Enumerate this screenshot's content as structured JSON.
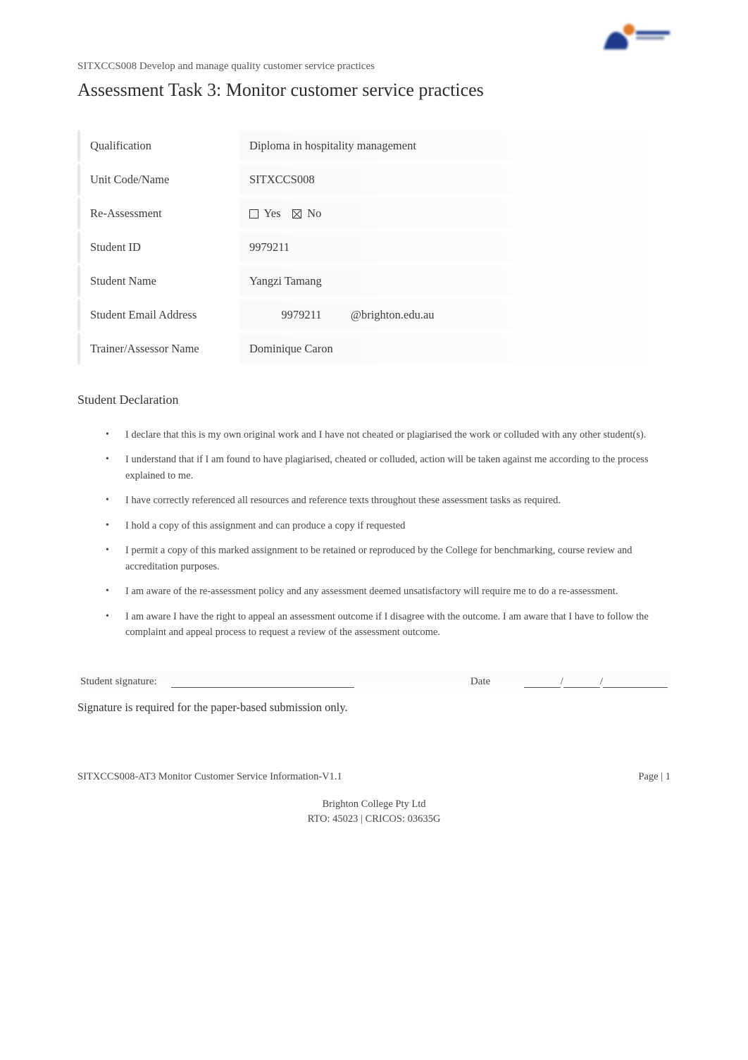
{
  "header": {
    "course_code_line": "SITXCCS008 Develop and manage quality customer service practices",
    "title": "Assessment Task 3: Monitor customer service practices"
  },
  "info_rows": {
    "qualification_label": "Qualification",
    "qualification_value": "Diploma in hospitality management",
    "unitcodename_label": "Unit Code/Name",
    "unitcodename_value": "SITXCCS008",
    "reassess_label": "Re-Assessment",
    "reassess_yes": "Yes",
    "reassess_no": "No",
    "studentid_label": "Student ID",
    "studentid_value": "9979211",
    "studentname_label": "Student Name",
    "studentname_value": "Yangzi Tamang",
    "email_label": "Student Email Address",
    "email_id": "9979211",
    "email_domain": "@brighton.edu.au",
    "trainer_label": "Trainer/Assessor Name",
    "trainer_value": "Dominique Caron"
  },
  "declaration": {
    "heading": "Student Declaration",
    "items": [
      "I declare that this is my own original work and I have not cheated or plagiarised the work or colluded with any other student(s).",
      "I understand that if I am found to have plagiarised, cheated or colluded, action will be taken against me according to the process explained to me.",
      "I have correctly referenced all resources and reference texts throughout these assessment tasks as required.",
      "I hold a copy of this assignment and can produce a copy if requested",
      "I permit a copy of this marked assignment to be retained or reproduced by the College for benchmarking, course review and accreditation purposes.",
      "I am aware of the re-assessment policy and any assessment deemed unsatisfactory will require me to do a re-assessment.",
      "I am aware I have the right to appeal an assessment outcome if I disagree with the outcome. I am aware that I have to follow the complaint and appeal process to request a review of the assessment outcome."
    ]
  },
  "signature": {
    "label": "Student signature:",
    "date_label": "Date",
    "note": "Signature is required for the paper-based submission only."
  },
  "footer": {
    "doc_id": "SITXCCS008-AT3 Monitor Customer Service Information-V1.1",
    "page": "Page | 1",
    "org_line1": "Brighton College Pty Ltd",
    "org_line2": "RTO: 45023 | CRICOS: 03635G"
  }
}
